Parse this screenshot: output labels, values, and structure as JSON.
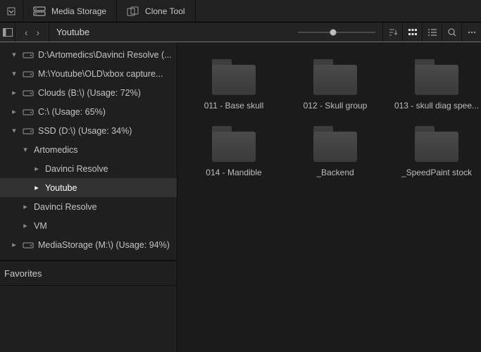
{
  "menubar": {
    "mediaStorage": "Media Storage",
    "cloneTool": "Clone Tool"
  },
  "pathbar": {
    "breadcrumb": "Youtube",
    "sliderPercent": 45
  },
  "tree": [
    {
      "kind": "drive",
      "depth": 0,
      "chev": "down",
      "label": "D:\\Artomedics\\Davinci Resolve (..."
    },
    {
      "kind": "drive",
      "depth": 0,
      "chev": "down",
      "label": "M:\\Youtube\\OLD\\xbox capture..."
    },
    {
      "kind": "drive",
      "depth": 0,
      "chev": "right",
      "label": "Clouds (B:\\) (Usage: 72%)"
    },
    {
      "kind": "drive",
      "depth": 0,
      "chev": "right",
      "label": "C:\\ (Usage: 65%)"
    },
    {
      "kind": "drive",
      "depth": 0,
      "chev": "down",
      "label": "SSD (D:\\) (Usage: 34%)"
    },
    {
      "kind": "folder",
      "depth": 1,
      "chev": "down",
      "label": "Artomedics"
    },
    {
      "kind": "folder",
      "depth": 2,
      "chev": "right",
      "label": "Davinci Resolve"
    },
    {
      "kind": "folder",
      "depth": 2,
      "chev": "right",
      "label": "Youtube",
      "selected": true
    },
    {
      "kind": "folder",
      "depth": 1,
      "chev": "right",
      "label": "Davinci Resolve"
    },
    {
      "kind": "folder",
      "depth": 1,
      "chev": "right",
      "label": "VM"
    },
    {
      "kind": "drive",
      "depth": 0,
      "chev": "right",
      "label": "MediaStorage (M:\\) (Usage: 94%)"
    }
  ],
  "favorites": {
    "label": "Favorites"
  },
  "folders": [
    {
      "name": "011 - Base skull"
    },
    {
      "name": "012 - Skull group"
    },
    {
      "name": "013 - skull diag spee..."
    },
    {
      "name": "014 - Mandible"
    },
    {
      "name": "_Backend"
    },
    {
      "name": "_SpeedPaint stock"
    }
  ]
}
